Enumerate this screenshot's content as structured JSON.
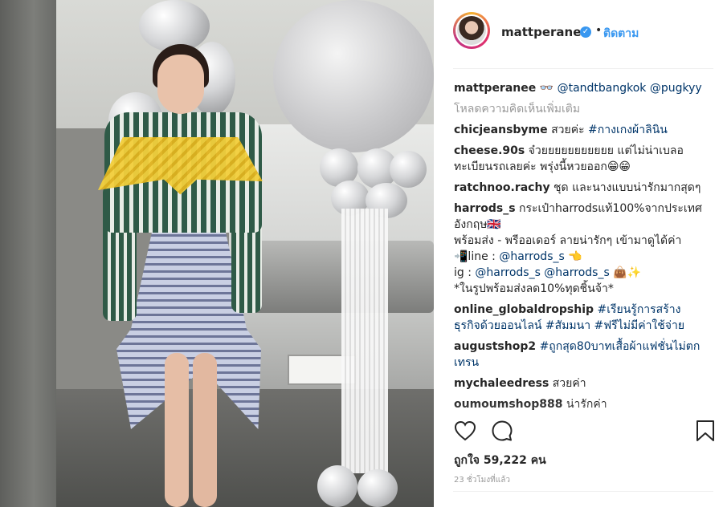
{
  "header": {
    "username": "mattperanee",
    "dot": "•",
    "follow_label": "ติดตาม"
  },
  "caption": {
    "username": "mattperanee",
    "emoji": "👓",
    "mentions": "@tandtbangkok @pugkyy"
  },
  "load_more": "โหลดความคิดเห็นเพิ่มเติม",
  "comments": [
    {
      "user": "chicjeansbyme",
      "text": "สวยค่ะ",
      "link": "#กางเกงผ้าลินิน"
    },
    {
      "user": "cheese.90s",
      "text": "จ๋วยยยยยยยยยยย แต่ไม่น่าเบลอทะเบียนรถเลยค่ะ พรุ่งนี้หวยออก😁😁"
    },
    {
      "user": "ratchnoo.rachy",
      "text": "ชุด และนางแบบน่ารักมากสุดๆ"
    },
    {
      "user": "harrods_s",
      "line1": "กระเป๋าharrodsแท้100%จากประเทศอังกฤษ🇬🇧",
      "line2": "พร้อมส่ง - พรีออเดอร์ ลายน่ารักๆ เข้ามาดูได้ค่า",
      "line3_pre": "📲line : ",
      "line3_link": "@harrods_s",
      "line3_post": " 👈",
      "line4_pre": "ig : ",
      "line4_link": "@harrods_s @harrods_s",
      "line4_post": " 👜✨",
      "line5": "*ในรูปพร้อมส่งลด10%ทุดชิ้นจ้า*"
    },
    {
      "user": "online_globaldropship",
      "link": "#เรียนรู้การสร้างธุรกิจด้วยออนไลน์ #สัมมนา #ฟรีไม่มีค่าใช้จ่าย"
    },
    {
      "user": "augustshop2",
      "link": "#ถูกสุด80บาทเสื้อผ้าแฟชั่นไม่ตกเทรน"
    },
    {
      "user": "mychaleedress",
      "text": "สวยค่า"
    },
    {
      "user": "oumoumshop888",
      "text": "น่ารักค่า"
    }
  ],
  "likes": "ถูกใจ 59,222 คน",
  "time": "23 ชั่วโมงที่แล้ว",
  "icons": [
    "heart-icon",
    "comment-icon",
    "bookmark-icon",
    "verified-icon"
  ],
  "colors": {
    "link": "#003569",
    "follow": "#3897f0",
    "muted": "#999999"
  }
}
